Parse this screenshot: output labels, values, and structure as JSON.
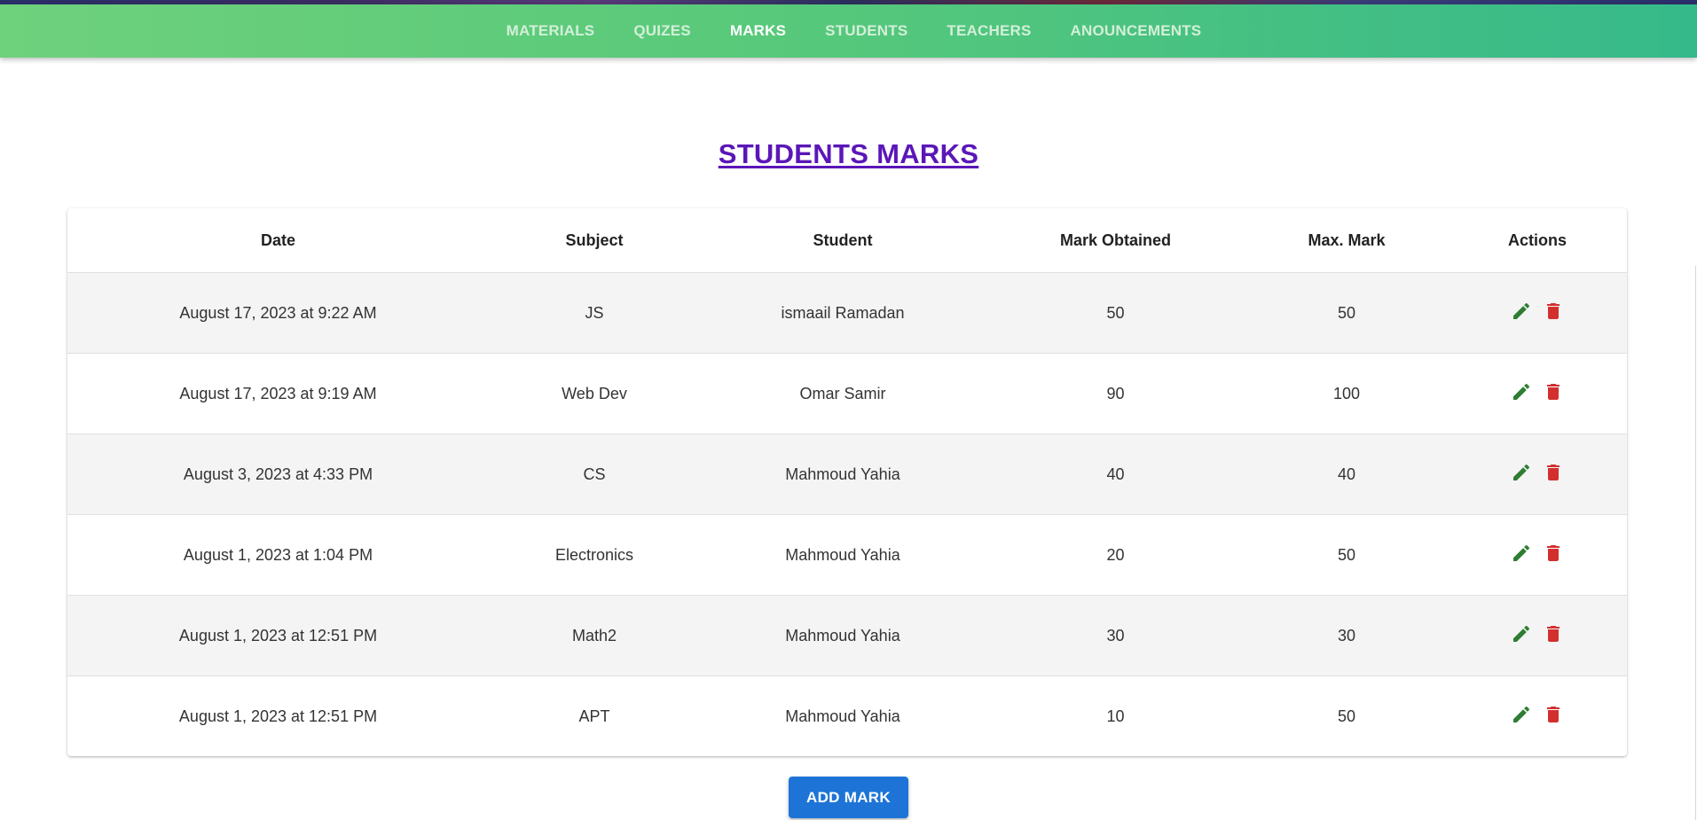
{
  "nav": {
    "items": [
      {
        "label": "MATERIALS",
        "active": false
      },
      {
        "label": "QUIZES",
        "active": false
      },
      {
        "label": "MARKS",
        "active": true
      },
      {
        "label": "STUDENTS",
        "active": false
      },
      {
        "label": "TEACHERS",
        "active": false
      },
      {
        "label": "ANOUNCEMENTS",
        "active": false
      }
    ]
  },
  "page": {
    "title": "STUDENTS MARKS"
  },
  "table": {
    "headers": [
      "Date",
      "Subject",
      "Student",
      "Mark Obtained",
      "Max. Mark",
      "Actions"
    ],
    "rows": [
      {
        "date": "August 17, 2023 at 9:22 AM",
        "subject": "JS",
        "student": "ismaail Ramadan",
        "mark": "50",
        "max": "50"
      },
      {
        "date": "August 17, 2023 at 9:19 AM",
        "subject": "Web Dev",
        "student": "Omar Samir",
        "mark": "90",
        "max": "100"
      },
      {
        "date": "August 3, 2023 at 4:33 PM",
        "subject": "CS",
        "student": "Mahmoud Yahia",
        "mark": "40",
        "max": "40"
      },
      {
        "date": "August 1, 2023 at 1:04 PM",
        "subject": "Electronics",
        "student": "Mahmoud Yahia",
        "mark": "20",
        "max": "50"
      },
      {
        "date": "August 1, 2023 at 12:51 PM",
        "subject": "Math2",
        "student": "Mahmoud Yahia",
        "mark": "30",
        "max": "30"
      },
      {
        "date": "August 1, 2023 at 12:51 PM",
        "subject": "APT",
        "student": "Mahmoud Yahia",
        "mark": "10",
        "max": "50"
      }
    ],
    "row_actions": [
      {
        "icon": "pencil-icon",
        "color": "#2e7d32"
      },
      {
        "icon": "trash-icon",
        "color": "#d32f2f"
      }
    ]
  },
  "add_button": {
    "label": "ADD MARK"
  },
  "colors": {
    "nav_gradient_start": "#6ed17c",
    "nav_gradient_end": "#36b98a",
    "title": "#5b16b8",
    "button": "#1e74d6",
    "edit_icon": "#2e7d32",
    "delete_icon": "#d32f2f"
  }
}
